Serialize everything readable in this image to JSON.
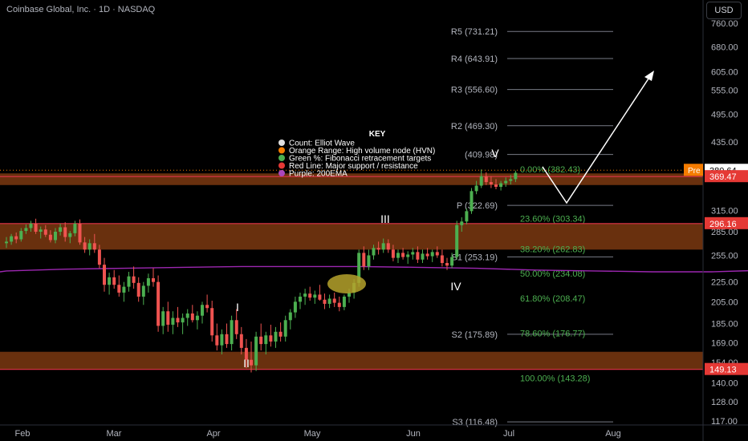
{
  "header": {
    "title": "Coinbase Global, Inc. · 1D · NASDAQ",
    "currency": "USD"
  },
  "colors": {
    "background": "#000000",
    "up": "#4caf50",
    "down": "#ef5350",
    "ema": "#9c27b0",
    "hvn": "#c0571a",
    "support_line": "#e0334a",
    "fib": "#4caf50",
    "pivot_line": "#787b86",
    "price_line": "#f57c00"
  },
  "chart_data": {
    "type": "candlestick",
    "y_axis": {
      "ticks": [
        "760.00",
        "680.00",
        "605.00",
        "555.00",
        "495.00",
        "435.00",
        "375.00",
        "315.00",
        "285.00",
        "255.00",
        "225.00",
        "205.00",
        "185.00",
        "169.00",
        "154.00",
        "140.00",
        "128.00",
        "117.00"
      ],
      "scale": "log"
    },
    "x_axis": {
      "ticks": [
        "Feb",
        "Mar",
        "Apr",
        "May",
        "Jun",
        "Jul",
        "Aug"
      ]
    },
    "price_labels": [
      {
        "text": "Pre",
        "value": "380.64",
        "style": "pre"
      },
      {
        "text": "",
        "value": "373.85",
        "style": "plain"
      },
      {
        "text": "",
        "value": "369.47",
        "style": "down"
      },
      {
        "text": "",
        "value": "296.16",
        "style": "down"
      },
      {
        "text": "",
        "value": "149.13",
        "style": "down"
      }
    ],
    "pivots": [
      {
        "label": "R5 (731.21)",
        "value": 731.21
      },
      {
        "label": "R4 (643.91)",
        "value": 643.91
      },
      {
        "label": "R3 (556.60)",
        "value": 556.6
      },
      {
        "label": "R2 (469.30)",
        "value": 469.3
      },
      {
        "label": "(409.98)",
        "value": 409.98
      },
      {
        "label": "P (322.69)",
        "value": 322.69
      },
      {
        "label": "S1 (253.19)",
        "value": 253.19
      },
      {
        "label": "S2 (175.89)",
        "value": 175.89
      },
      {
        "label": "S3 (116.48)",
        "value": 116.48
      }
    ],
    "fib_levels": [
      {
        "label": "0.00% (382.43)",
        "value": 382.43
      },
      {
        "label": "23.60% (303.34)",
        "value": 303.34
      },
      {
        "label": "38.20% (262.83)",
        "value": 262.83
      },
      {
        "label": "50.00% (234.08)",
        "value": 234.08
      },
      {
        "label": "61.80% (208.47)",
        "value": 208.47
      },
      {
        "label": "78.60% (176.77)",
        "value": 176.77
      },
      {
        "label": "100.00% (143.28)",
        "value": 143.28
      }
    ],
    "hvn_zones": [
      [
        355,
        375
      ],
      [
        262,
        296
      ],
      [
        149,
        162
      ]
    ],
    "support_lines": [
      369.47,
      296.16,
      149.13
    ],
    "wave_labels": [
      "I",
      "II",
      "III",
      "IV",
      "V"
    ],
    "legend": {
      "title": "KEY",
      "items": [
        {
          "text": "Count: Elliot Wave",
          "color": "#e0e0e0"
        },
        {
          "text": "Orange Range: High volume node (HVN)",
          "color": "#f57c00"
        },
        {
          "text": "Green %: Fibonacci retracement targets",
          "color": "#4caf50"
        },
        {
          "text": "Red Line: Major support / resistance",
          "color": "#e53935"
        },
        {
          "text": "Purple: 200EMA",
          "color": "#ab47bc"
        }
      ]
    },
    "candles": [
      [
        270,
        278,
        264,
        272
      ],
      [
        272,
        282,
        268,
        279
      ],
      [
        279,
        284,
        270,
        275
      ],
      [
        275,
        290,
        272,
        286
      ],
      [
        286,
        295,
        282,
        290
      ],
      [
        290,
        300,
        285,
        296
      ],
      [
        296,
        303,
        282,
        285
      ],
      [
        285,
        292,
        276,
        288
      ],
      [
        288,
        294,
        278,
        281
      ],
      [
        281,
        287,
        271,
        274
      ],
      [
        274,
        290,
        270,
        285
      ],
      [
        285,
        296,
        280,
        291
      ],
      [
        291,
        298,
        272,
        278
      ],
      [
        278,
        286,
        270,
        283
      ],
      [
        283,
        300,
        279,
        296
      ],
      [
        296,
        302,
        268,
        271
      ],
      [
        271,
        278,
        258,
        262
      ],
      [
        262,
        275,
        255,
        270
      ],
      [
        270,
        282,
        258,
        262
      ],
      [
        262,
        268,
        240,
        244
      ],
      [
        244,
        252,
        215,
        222
      ],
      [
        222,
        235,
        212,
        230
      ],
      [
        230,
        238,
        218,
        222
      ],
      [
        222,
        232,
        210,
        214
      ],
      [
        214,
        225,
        205,
        220
      ],
      [
        220,
        236,
        215,
        231
      ],
      [
        231,
        242,
        218,
        224
      ],
      [
        224,
        230,
        205,
        210
      ],
      [
        210,
        225,
        202,
        221
      ],
      [
        221,
        234,
        214,
        229
      ],
      [
        229,
        240,
        220,
        225
      ],
      [
        225,
        232,
        178,
        183
      ],
      [
        183,
        200,
        176,
        196
      ],
      [
        196,
        205,
        178,
        184
      ],
      [
        184,
        196,
        176,
        190
      ],
      [
        190,
        200,
        182,
        186
      ],
      [
        186,
        194,
        176,
        190
      ],
      [
        190,
        198,
        183,
        194
      ],
      [
        194,
        202,
        186,
        188
      ],
      [
        188,
        196,
        180,
        192
      ],
      [
        192,
        205,
        185,
        202
      ],
      [
        202,
        212,
        195,
        199
      ],
      [
        199,
        206,
        170,
        175
      ],
      [
        175,
        185,
        163,
        167
      ],
      [
        167,
        180,
        160,
        176
      ],
      [
        176,
        185,
        165,
        168
      ],
      [
        168,
        192,
        163,
        188
      ],
      [
        188,
        198,
        172,
        176
      ],
      [
        176,
        182,
        160,
        165
      ],
      [
        165,
        172,
        150,
        156
      ],
      [
        156,
        170,
        147,
        152
      ],
      [
        152,
        178,
        148,
        174
      ],
      [
        174,
        185,
        163,
        168
      ],
      [
        168,
        178,
        160,
        175
      ],
      [
        175,
        184,
        166,
        170
      ],
      [
        170,
        182,
        165,
        178
      ],
      [
        178,
        186,
        170,
        174
      ],
      [
        174,
        192,
        170,
        188
      ],
      [
        188,
        198,
        180,
        195
      ],
      [
        195,
        210,
        190,
        205
      ],
      [
        205,
        214,
        198,
        210
      ],
      [
        210,
        218,
        202,
        213
      ],
      [
        213,
        220,
        206,
        209
      ],
      [
        209,
        216,
        203,
        212
      ],
      [
        212,
        222,
        206,
        207
      ],
      [
        207,
        213,
        198,
        203
      ],
      [
        203,
        212,
        199,
        208
      ],
      [
        208,
        214,
        200,
        204
      ],
      [
        204,
        210,
        196,
        200
      ],
      [
        200,
        212,
        197,
        210
      ],
      [
        210,
        218,
        204,
        214
      ],
      [
        214,
        228,
        208,
        224
      ],
      [
        224,
        262,
        220,
        258
      ],
      [
        258,
        266,
        238,
        242
      ],
      [
        242,
        262,
        238,
        255
      ],
      [
        255,
        268,
        250,
        264
      ],
      [
        264,
        272,
        256,
        262
      ],
      [
        262,
        276,
        258,
        270
      ],
      [
        270,
        275,
        258,
        262
      ],
      [
        262,
        268,
        248,
        252
      ],
      [
        252,
        262,
        246,
        258
      ],
      [
        258,
        264,
        250,
        253
      ],
      [
        253,
        260,
        245,
        256
      ],
      [
        256,
        264,
        250,
        259
      ],
      [
        259,
        266,
        246,
        250
      ],
      [
        250,
        262,
        246,
        257
      ],
      [
        257,
        264,
        250,
        254
      ],
      [
        254,
        262,
        247,
        259
      ],
      [
        259,
        266,
        252,
        255
      ],
      [
        255,
        262,
        242,
        246
      ],
      [
        246,
        252,
        238,
        243
      ],
      [
        243,
        258,
        240,
        253
      ],
      [
        253,
        300,
        250,
        294
      ],
      [
        294,
        305,
        285,
        299
      ],
      [
        299,
        318,
        295,
        314
      ],
      [
        314,
        350,
        310,
        345
      ],
      [
        345,
        362,
        340,
        354
      ],
      [
        354,
        382,
        350,
        370
      ],
      [
        370,
        377,
        355,
        360
      ],
      [
        360,
        370,
        350,
        356
      ],
      [
        356,
        365,
        348,
        352
      ],
      [
        352,
        362,
        346,
        358
      ],
      [
        358,
        368,
        352,
        362
      ],
      [
        362,
        372,
        356,
        365
      ],
      [
        365,
        380,
        360,
        376
      ]
    ],
    "ema200": [
      [
        0,
        237
      ],
      [
        12,
        239
      ],
      [
        24,
        240
      ],
      [
        36,
        241
      ],
      [
        48,
        242
      ],
      [
        60,
        242
      ],
      [
        72,
        242
      ],
      [
        84,
        241
      ],
      [
        96,
        240
      ],
      [
        108,
        238
      ],
      [
        120,
        237
      ],
      [
        132,
        236
      ],
      [
        144,
        236
      ],
      [
        156,
        238
      ],
      [
        166,
        240
      ]
    ]
  }
}
